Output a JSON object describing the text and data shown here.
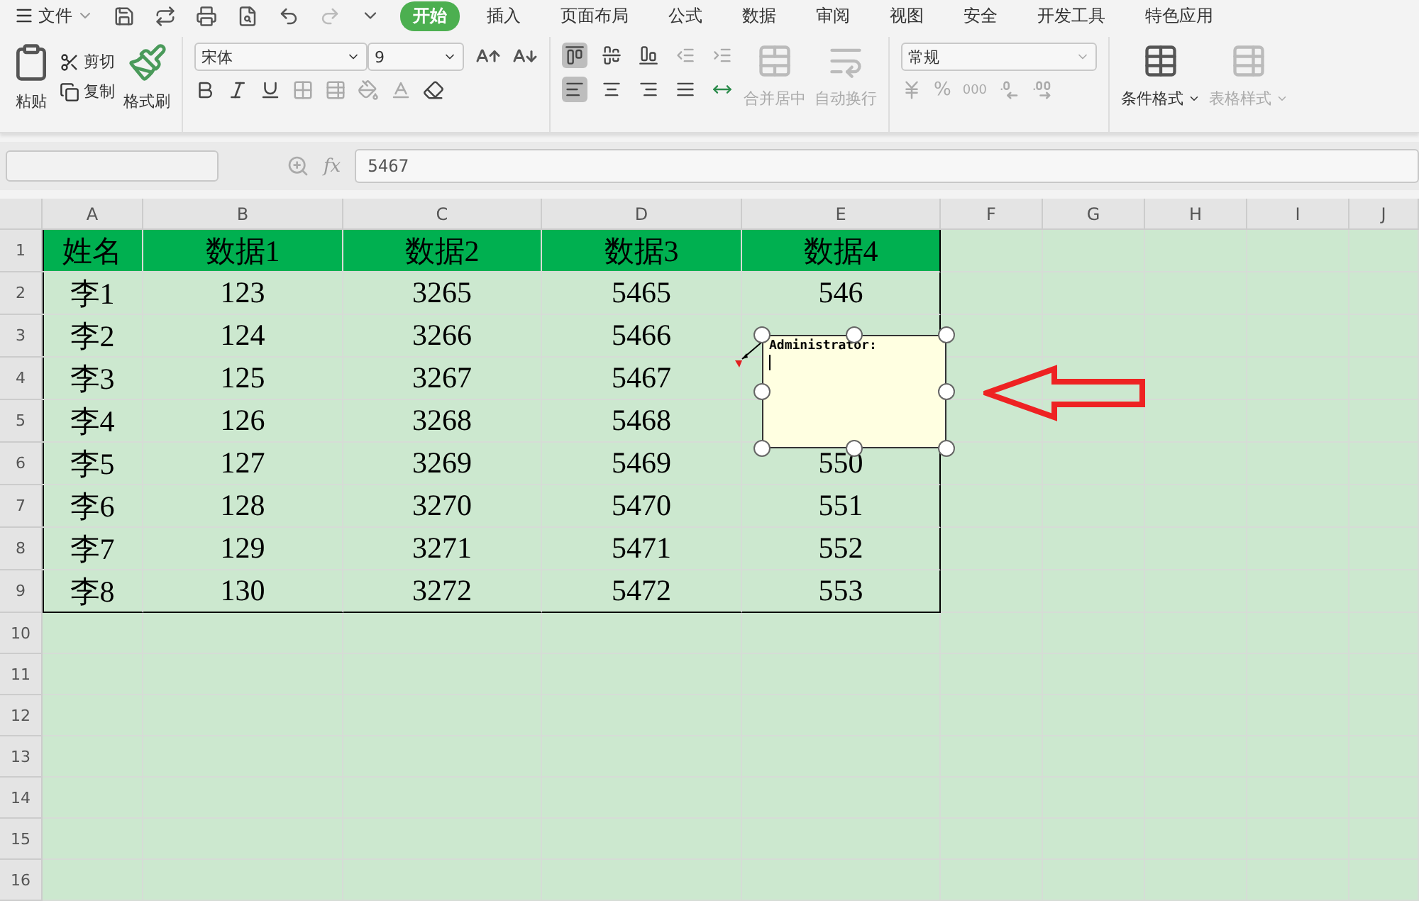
{
  "menu": {
    "label": "文件"
  },
  "tabs": [
    {
      "label": "开始",
      "selected": true
    },
    {
      "label": "插入",
      "selected": false
    },
    {
      "label": "页面布局",
      "selected": false
    },
    {
      "label": "公式",
      "selected": false
    },
    {
      "label": "数据",
      "selected": false
    },
    {
      "label": "审阅",
      "selected": false
    },
    {
      "label": "视图",
      "selected": false
    },
    {
      "label": "安全",
      "selected": false
    },
    {
      "label": "开发工具",
      "selected": false
    },
    {
      "label": "特色应用",
      "selected": false
    }
  ],
  "clipboard": {
    "paste": "粘贴",
    "cut": "剪切",
    "copy": "复制",
    "format_painter": "格式刷"
  },
  "font": {
    "name": "宋体",
    "size": "9"
  },
  "alignment": [
    {
      "label": "合并居中",
      "disabled": true
    },
    {
      "label": "自动换行",
      "disabled": true
    }
  ],
  "number": {
    "format": "常规",
    "percent": "%",
    "thousands": "000"
  },
  "styles": [
    {
      "label": "条件格式",
      "disabled": false
    },
    {
      "label": "表格样式",
      "disabled": true
    }
  ],
  "formula_bar": {
    "fx": "fx",
    "value": "5467"
  },
  "sheet": {
    "columns": [
      "A",
      "B",
      "C",
      "D",
      "E",
      "F",
      "G",
      "H",
      "I",
      "J"
    ],
    "header_row": {
      "number": "1",
      "cells": [
        "姓名",
        "数据1",
        "数据2",
        "数据3",
        "数据4"
      ]
    },
    "rows": [
      {
        "number": "2",
        "cells": [
          "李1",
          "123",
          "3265",
          "5465",
          "546"
        ]
      },
      {
        "number": "3",
        "cells": [
          "李2",
          "124",
          "3266",
          "5466"
        ]
      },
      {
        "number": "4",
        "cells": [
          "李3",
          "125",
          "3267",
          "5467"
        ]
      },
      {
        "number": "5",
        "cells": [
          "李4",
          "126",
          "3268",
          "5468"
        ]
      },
      {
        "number": "6",
        "cells": [
          "李5",
          "127",
          "3269",
          "5469",
          "550"
        ]
      },
      {
        "number": "7",
        "cells": [
          "李6",
          "128",
          "3270",
          "5470",
          "551"
        ]
      },
      {
        "number": "8",
        "cells": [
          "李7",
          "129",
          "3271",
          "5471",
          "552"
        ]
      },
      {
        "number": "9",
        "cells": [
          "李8",
          "130",
          "3272",
          "5472",
          "553"
        ]
      },
      {
        "number": "10"
      },
      {
        "number": "11"
      },
      {
        "number": "12"
      },
      {
        "number": "13"
      },
      {
        "number": "14"
      },
      {
        "number": "15"
      },
      {
        "number": "16"
      }
    ]
  },
  "comment": {
    "author": "Administrator:"
  }
}
